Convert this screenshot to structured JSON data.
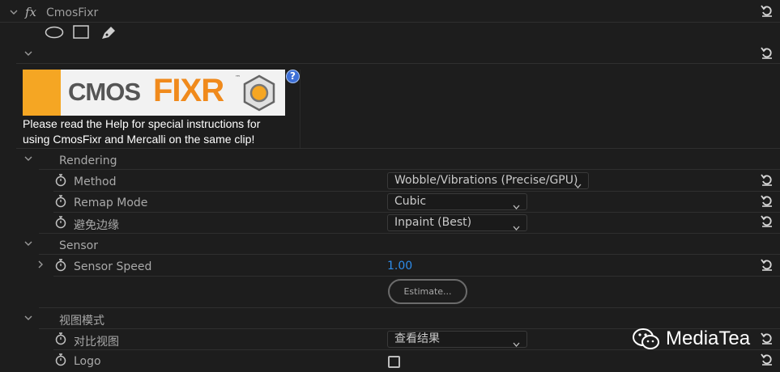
{
  "effect": {
    "fx_symbol": "fx",
    "name": "CmosFixr"
  },
  "mask_tools": [
    "ellipse-icon",
    "rectangle-icon",
    "pen-icon"
  ],
  "logo": {
    "text_cmos": "CMOS",
    "text_fixr": "FIXR",
    "tm": "™"
  },
  "help_text_line1": "Please read the Help for special instructions for",
  "help_text_line2": "using CmosFixr and Mercalli on the same clip!",
  "help_icon": "?",
  "groups": {
    "rendering": "Rendering",
    "sensor": "Sensor",
    "view_mode": "视图模式"
  },
  "params": {
    "method": {
      "label": "Method",
      "value": "Wobble/Vibrations  (Precise/GPU)"
    },
    "remap_mode": {
      "label": "Remap Mode",
      "value": "Cubic"
    },
    "avoid_edges": {
      "label": "避免边缘",
      "value": "Inpaint (Best)"
    },
    "sensor_speed": {
      "label": "Sensor Speed",
      "value": "1.00"
    },
    "estimate_button": "Estimate...",
    "compare_view": {
      "label": "对比视图",
      "value": "查看结果"
    },
    "logo_param": {
      "label": "Logo",
      "checked": false
    }
  },
  "watermark": {
    "icon": "wechat-icon",
    "text": "MediaTea"
  },
  "colors": {
    "accent_blue": "#2d8ceb",
    "logo_orange": "#f5a623",
    "background": "#1d1d1d"
  }
}
